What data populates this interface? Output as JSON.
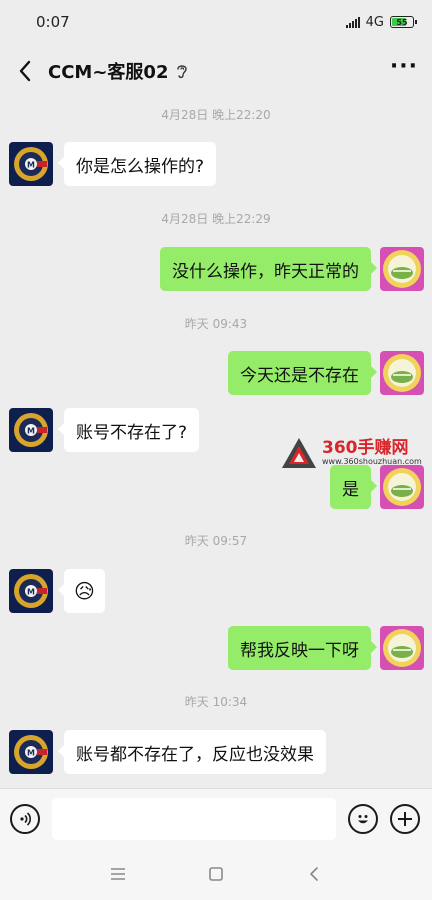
{
  "status_bar": {
    "time": "0:07",
    "network": "4G",
    "battery": "55"
  },
  "header": {
    "title": "CCM~客服02",
    "more_label": "···"
  },
  "messages": {
    "ts1": "4月28日 晚上22:20",
    "m1": "你是怎么操作的?",
    "ts2": "4月28日 晚上22:29",
    "m2": "没什么操作，昨天正常的",
    "ts3": "昨天 09:43",
    "m3": "今天还是不存在",
    "m4": "账号不存在了?",
    "m5": "是",
    "ts4": "昨天 09:57",
    "m6": "😥",
    "m7": "帮我反映一下呀",
    "ts5": "昨天 10:34",
    "m8": "账号都不存在了，反应也没效果"
  },
  "watermark": {
    "title": "360手赚网",
    "url": "www.360shouzhuan.com"
  },
  "input": {
    "placeholder": ""
  },
  "colors": {
    "background": "#ededed",
    "sent_bubble": "#95ec69",
    "received_bubble": "#ffffff"
  },
  "icons": {
    "back": "chevron-left-icon",
    "voice": "voice-icon",
    "emoji": "emoji-icon",
    "plus": "plus-icon"
  }
}
